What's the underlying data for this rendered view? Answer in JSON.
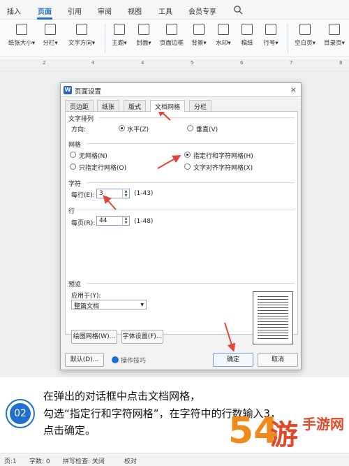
{
  "menu": {
    "tabs": [
      "插入",
      "页面",
      "引用",
      "审阅",
      "视图",
      "工具",
      "会员专享"
    ],
    "active": "页面"
  },
  "ribbon": {
    "buttons": [
      "纸张大小",
      "分栏",
      "文字方向",
      "主题",
      "封面",
      "页面边框",
      "背景",
      "水印",
      "稿纸",
      "行号",
      "空白页",
      "目录页"
    ]
  },
  "ruler": {
    "ticks": [
      "2",
      "3",
      "4",
      "5",
      "6",
      "7",
      "8"
    ]
  },
  "dialog": {
    "title": "页面设置",
    "logo": "W",
    "close": "×",
    "tabs": [
      "页边距",
      "纸张",
      "版式",
      "文档网格",
      "分栏"
    ],
    "active_tab": "文档网格",
    "text_direction": {
      "heading": "文字排列",
      "label": "方向:",
      "horizontal": "水平(Z)",
      "vertical": "垂直(V)",
      "selected": "水平(Z)"
    },
    "grid": {
      "heading": "网格",
      "no_grid": "无网格(N)",
      "line_only": "只指定行网格(O)",
      "line_and_char": "指定行和字符网格(H)",
      "align_char": "文字对齐字符网格(X)",
      "selected": "指定行和字符网格(H)"
    },
    "chars": {
      "heading": "字符",
      "label": "每行(E):",
      "value": "3",
      "range": "(1-43)"
    },
    "lines": {
      "heading": "行",
      "label": "每页(R):",
      "value": "44",
      "range": "(1-48)"
    },
    "preview": {
      "heading": "预览",
      "apply_label": "应用于(Y):",
      "apply_value": "整篇文档"
    },
    "buttons": {
      "draw_grid": "绘图网格(W)...",
      "font_settings": "字体设置(F)...",
      "default": "默认(D)...",
      "tips": "操作技巧",
      "ok": "确定",
      "cancel": "取消"
    }
  },
  "instruction": {
    "step": "02",
    "lines": [
      "在弹出的对话框中点击文档网格，",
      "勾选“指定行和字符网格”，在字符中的行数输入3，",
      "点击确定。"
    ]
  },
  "status": {
    "page": "页:1",
    "words": "字数: 0",
    "spell": "拼写检查: 关闭",
    "proof": "校对"
  },
  "watermark": {
    "text": "54游手网",
    "brand": "手游网"
  },
  "colors": {
    "accent": "#1f6fd1",
    "arrow": "#e0443a"
  }
}
